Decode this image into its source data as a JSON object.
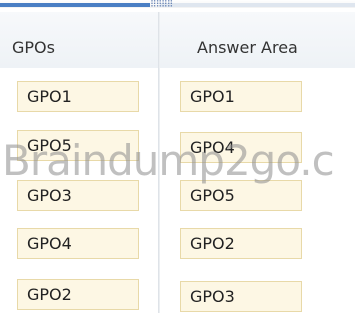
{
  "headers": {
    "left": "GPOs",
    "right": "Answer Area"
  },
  "left_items": [
    "GPO1",
    "GPO5",
    "GPO3",
    "GPO4",
    "GPO2"
  ],
  "right_items": [
    "GPO1",
    "GPO4",
    "GPO5",
    "GPO2",
    "GPO3"
  ],
  "watermark": "Braindump2go.c",
  "colors": {
    "item_background": "#fdf7e4",
    "item_border": "#e8d9a8",
    "accent": "#4a7fc4"
  }
}
